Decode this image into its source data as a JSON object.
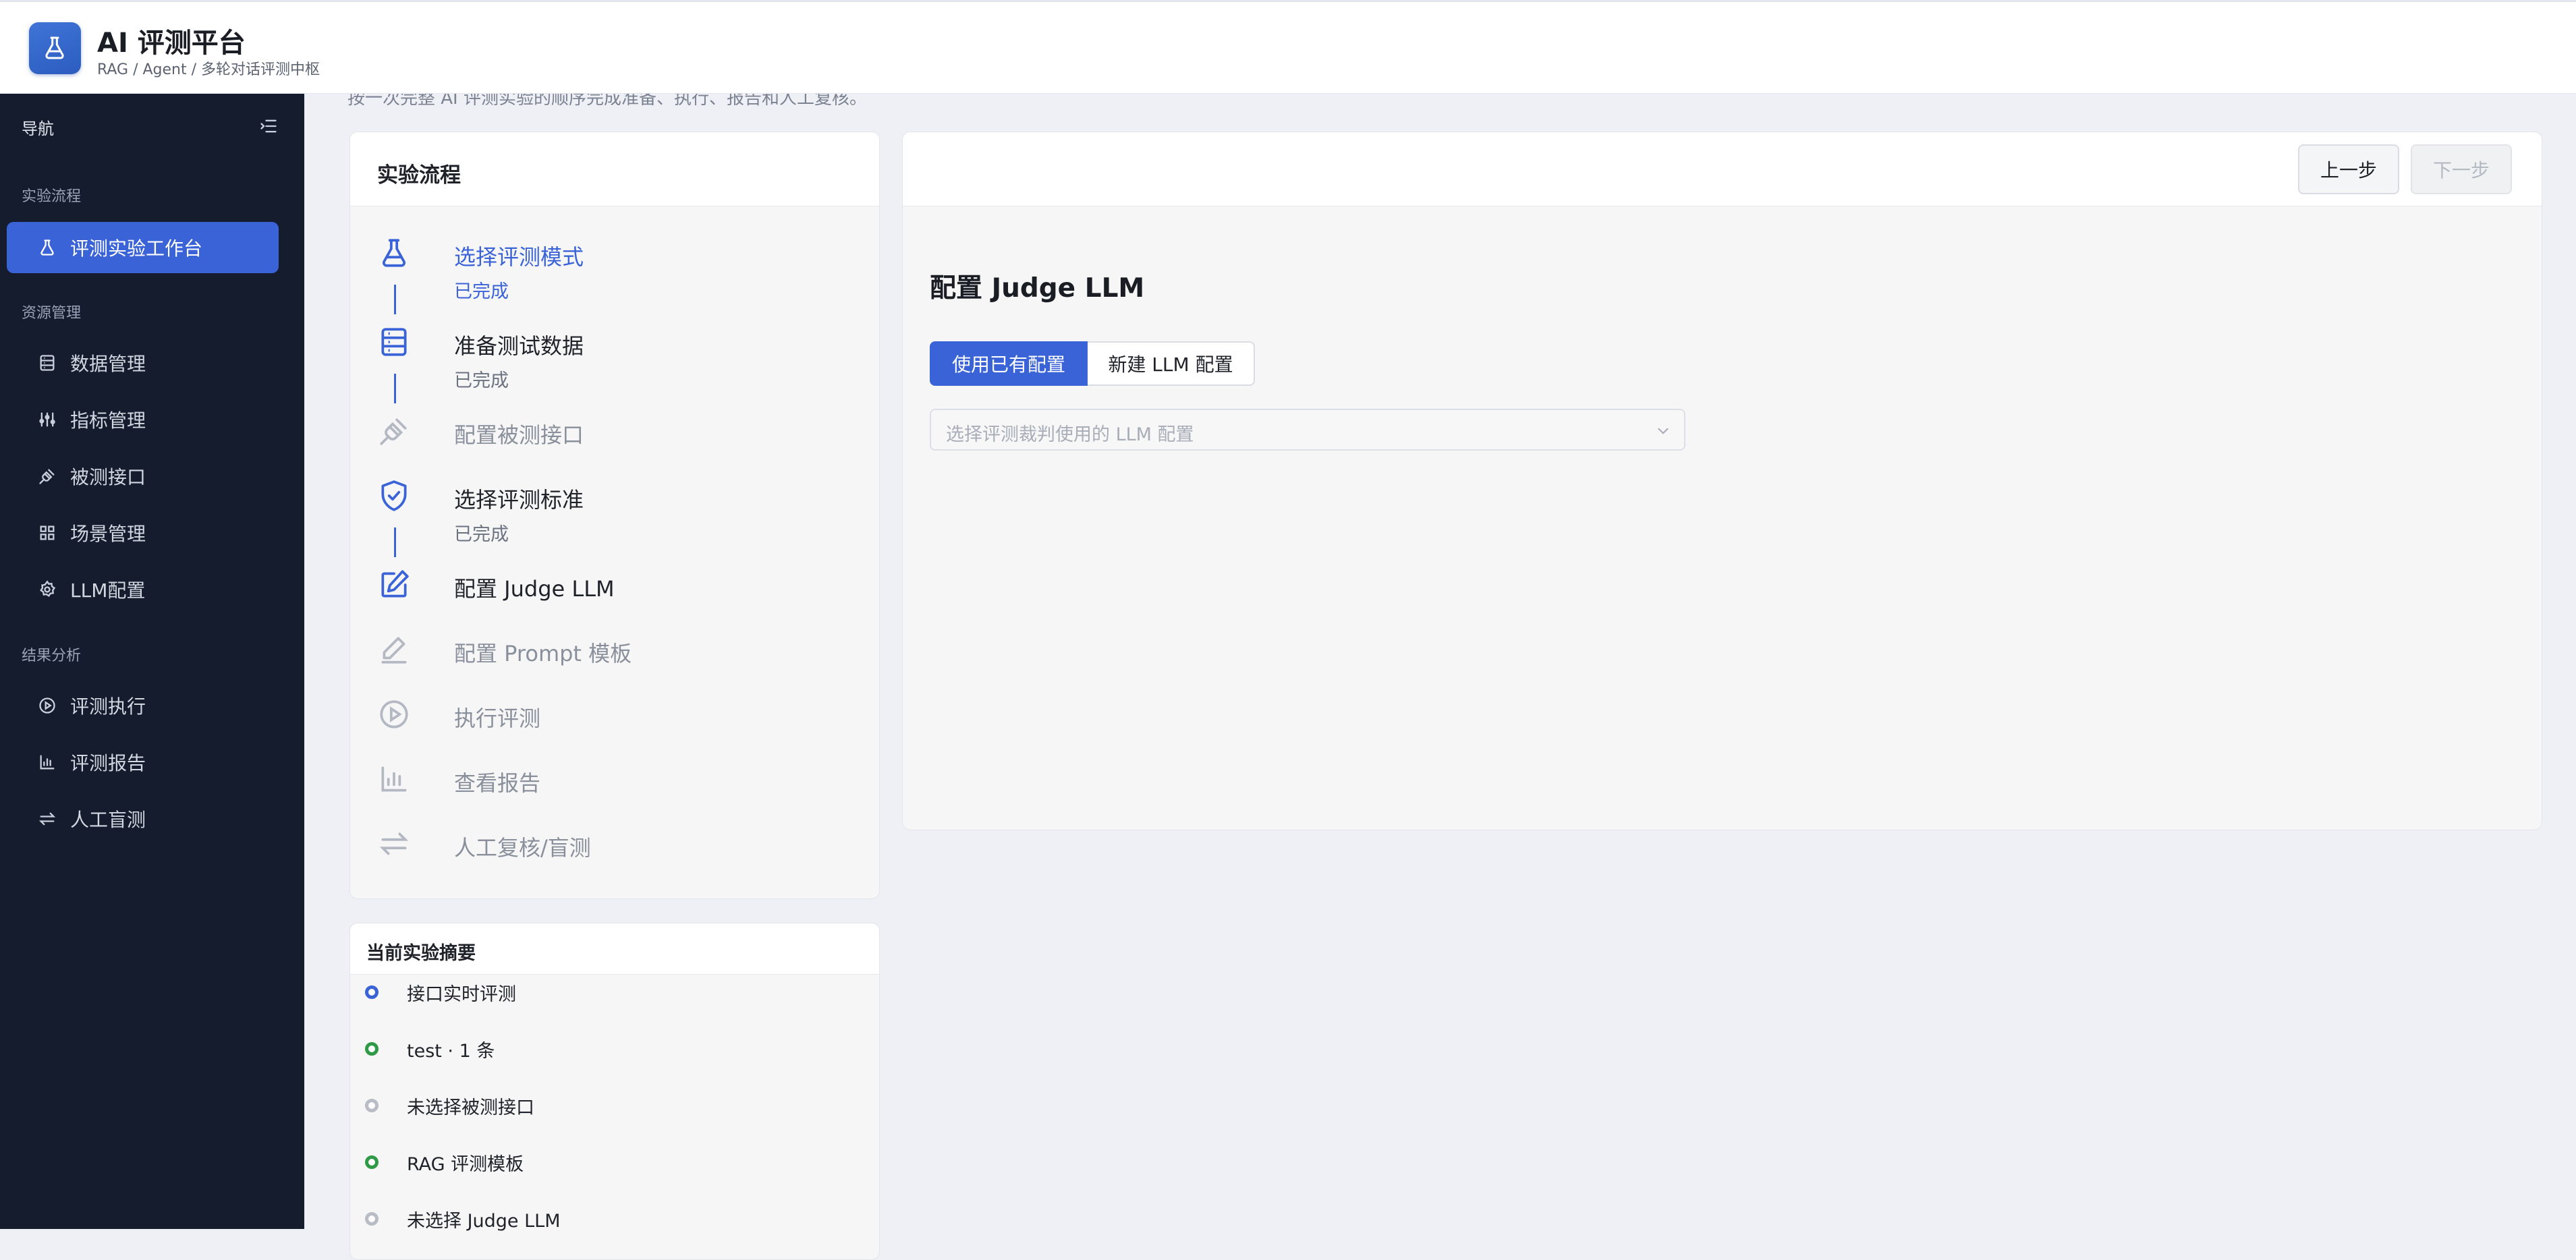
{
  "app": {
    "title": "AI 评测平台",
    "subtitle": "RAG / Agent / 多轮对话评测中枢"
  },
  "sidebar": {
    "nav_title": "导航",
    "groups": [
      {
        "label": "实验流程"
      },
      {
        "label": "资源管理"
      },
      {
        "label": "结果分析"
      }
    ],
    "items": [
      {
        "label": "评测实验工作台",
        "icon": "flask-icon",
        "active": true
      },
      {
        "label": "数据管理",
        "icon": "database-icon"
      },
      {
        "label": "指标管理",
        "icon": "sliders-icon"
      },
      {
        "label": "被测接口",
        "icon": "plug-icon"
      },
      {
        "label": "场景管理",
        "icon": "grid-icon"
      },
      {
        "label": "LLM配置",
        "icon": "gear-icon"
      },
      {
        "label": "评测执行",
        "icon": "play-icon"
      },
      {
        "label": "评测报告",
        "icon": "bar-chart-icon"
      },
      {
        "label": "人工盲测",
        "icon": "swap-icon"
      }
    ]
  },
  "main": {
    "hint": "按一次完整 AI 评测实验的顺序完成准备、执行、报告和人工复核。",
    "workflow": {
      "title": "实验流程",
      "steps": [
        {
          "label": "选择评测模式",
          "status": "已完成",
          "state": "done-current"
        },
        {
          "label": "准备测试数据",
          "status": "已完成",
          "state": "done"
        },
        {
          "label": "配置被测接口",
          "status": "",
          "state": "pending"
        },
        {
          "label": "选择评测标准",
          "status": "已完成",
          "state": "done"
        },
        {
          "label": "配置 Judge LLM",
          "status": "",
          "state": "active"
        },
        {
          "label": "配置 Prompt 模板",
          "status": "",
          "state": "pending"
        },
        {
          "label": "执行评测",
          "status": "",
          "state": "pending"
        },
        {
          "label": "查看报告",
          "status": "",
          "state": "pending"
        },
        {
          "label": "人工复核/盲测",
          "status": "",
          "state": "pending"
        }
      ]
    },
    "summary": {
      "title": "当前实验摘要",
      "items": [
        {
          "text": "接口实时评测",
          "color": "#3a63d8"
        },
        {
          "text": "test · 1 条",
          "color": "#2e9a45"
        },
        {
          "text": "未选择被测接口",
          "color": "#b8bcc4"
        },
        {
          "text": "RAG 评测模板",
          "color": "#2e9a45"
        },
        {
          "text": "未选择 Judge LLM",
          "color": "#b8bcc4"
        }
      ]
    },
    "panel": {
      "prev_label": "上一步",
      "next_label": "下一步",
      "section_title": "配置 Judge LLM",
      "seg_existing": "使用已有配置",
      "seg_new": "新建 LLM 配置",
      "select_placeholder": "选择评测裁判使用的 LLM 配置"
    }
  },
  "colors": {
    "accent": "#3a63d8",
    "sidebar_bg": "#141c2e",
    "success": "#2e9a45",
    "muted": "#b8bcc4"
  }
}
